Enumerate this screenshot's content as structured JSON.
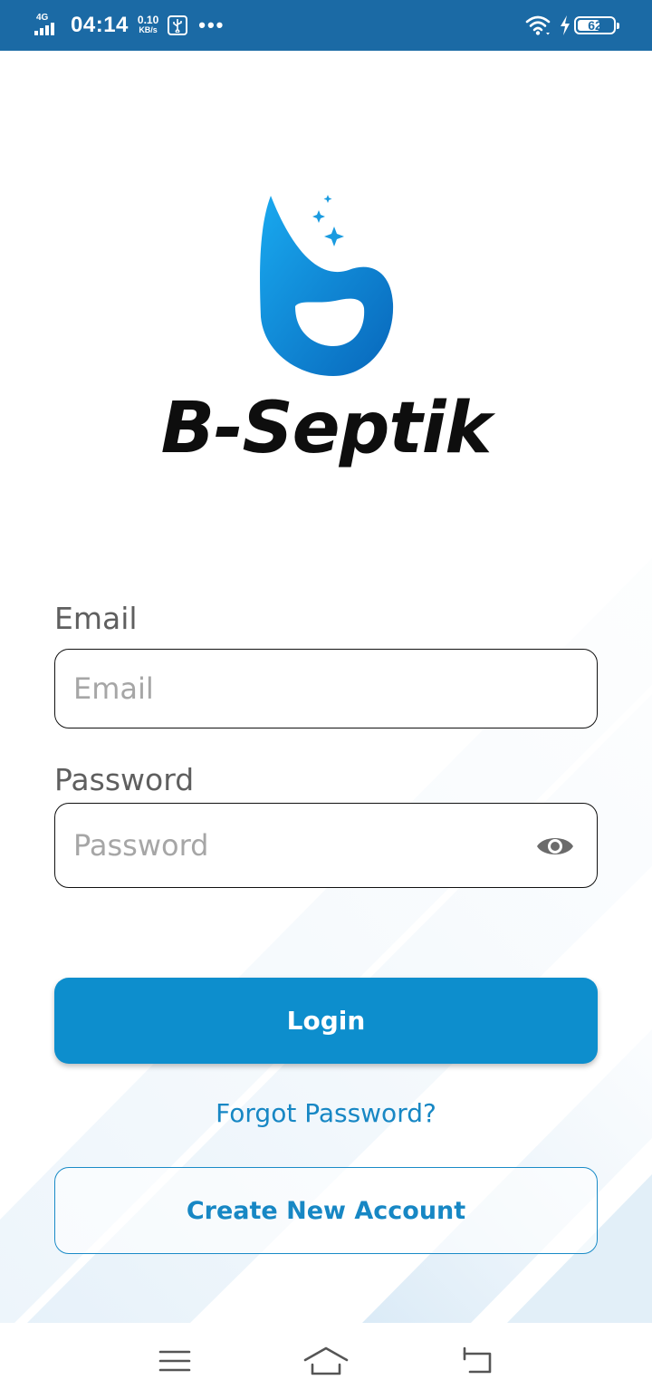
{
  "status_bar": {
    "network": "4G",
    "time": "04:14",
    "speed_value": "0.10",
    "speed_unit": "KB/s",
    "more_dots": "•••",
    "battery_percent": "62",
    "battery_level": 0.62,
    "icons": [
      "signal-icon",
      "usb-icon",
      "wifi-icon",
      "charging-bolt-icon",
      "battery-icon"
    ]
  },
  "brand": {
    "name": "B-Septik",
    "colors": {
      "accent": "#0d8ecd",
      "logo_light": "#1aa7ec",
      "logo_dark": "#0a6fbf",
      "status_bar": "#1b6aa5"
    }
  },
  "form": {
    "email_label": "Email",
    "email_placeholder": "Email",
    "email_value": "",
    "password_label": "Password",
    "password_placeholder": "Password",
    "password_value": "",
    "password_toggle_icon": "eye-icon"
  },
  "actions": {
    "login": "Login",
    "forgot_password": "Forgot Password?",
    "create_account": "Create New Account"
  },
  "nav_bar": {
    "icons": [
      "menu-icon",
      "home-icon",
      "back-icon"
    ]
  }
}
